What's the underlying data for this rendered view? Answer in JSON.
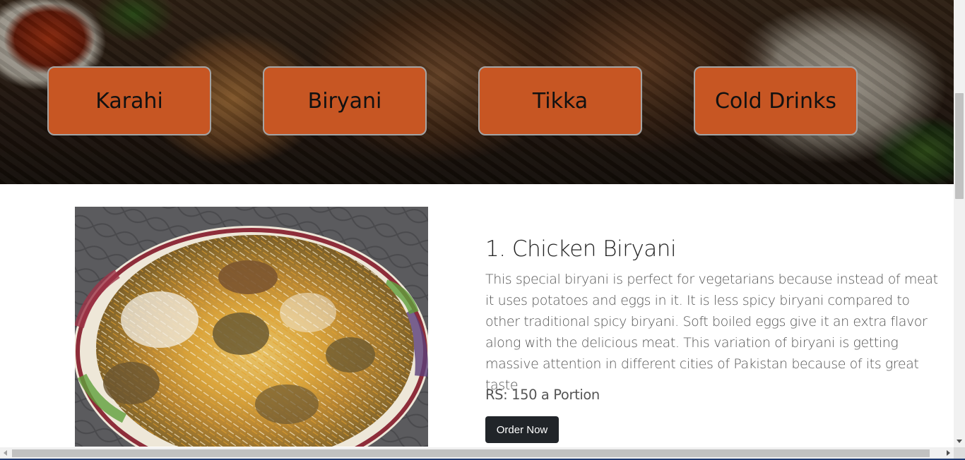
{
  "categories": [
    {
      "label": "Karahi"
    },
    {
      "label": "Biryani"
    },
    {
      "label": "Tikka"
    },
    {
      "label": "Cold Drinks"
    }
  ],
  "item": {
    "title": "1. Chicken Biryani",
    "description": "This special biryani is perfect for vegetarians because instead of meat it uses potatoes and eggs in it. It is less spicy biryani compared to other traditional spicy biryani. Soft boiled eggs give it an extra flavor along with the delicious meat. This variation of biryani is getting massive attention in different cities of Pakistan because of its great taste",
    "price": "RS: 150 a Portion",
    "order_label": "Order Now",
    "photo_icon": "biryani-photo"
  },
  "colors": {
    "category_button": "#c75623",
    "order_button": "#212529"
  }
}
